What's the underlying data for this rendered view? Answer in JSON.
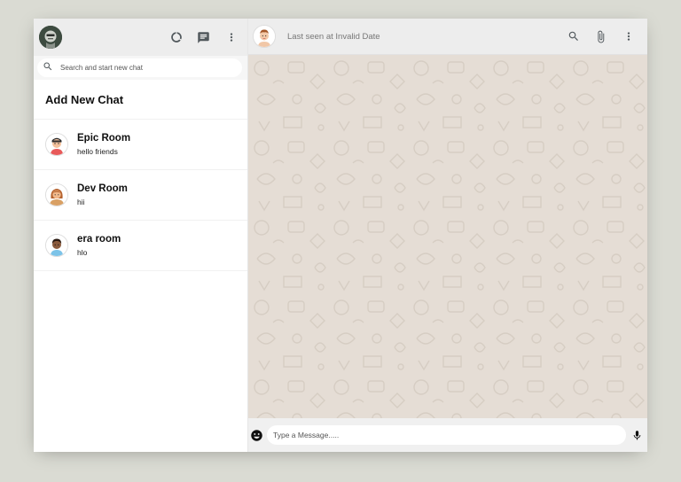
{
  "sidebar": {
    "header": {
      "icons": [
        "user-avatar",
        "status-icon",
        "new-chat-icon",
        "more-vert-icon"
      ]
    },
    "search": {
      "placeholder": "Search and start new chat"
    },
    "add_chat_label": "Add New Chat",
    "chats": [
      {
        "name": "Epic Room",
        "last_message": "hello friends"
      },
      {
        "name": "Dev Room",
        "last_message": "hii"
      },
      {
        "name": "era room",
        "last_message": "hlo"
      }
    ]
  },
  "chat": {
    "header": {
      "last_seen": "Last seen at Invalid Date",
      "icons": [
        "search-icon",
        "attach-icon",
        "more-vert-icon"
      ]
    },
    "footer": {
      "message_placeholder": "Type a Message.....",
      "icons": [
        "emoji-icon",
        "mic-icon"
      ]
    }
  },
  "colors": {
    "background": "#dadbd3",
    "header": "#ededed",
    "chat_wallpaper": "#e5ddd5",
    "icon": "#51585c"
  }
}
